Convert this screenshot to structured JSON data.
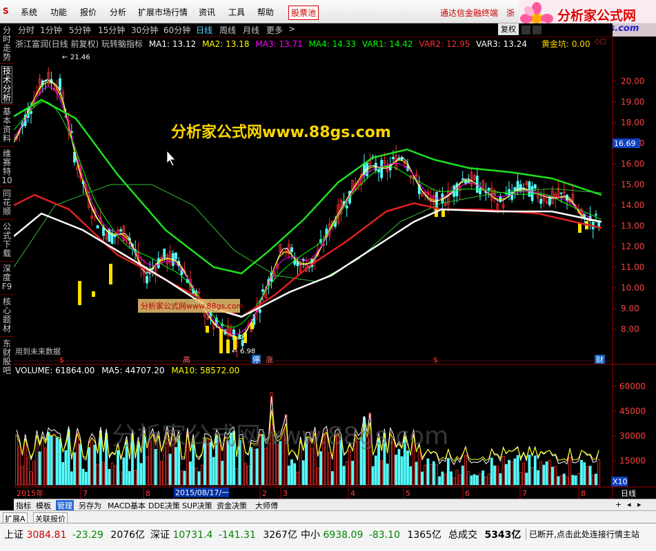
{
  "menu": {
    "items": [
      "系统",
      "功能",
      "报价",
      "分析",
      "扩展市场行情",
      "资讯",
      "工具",
      "帮助"
    ],
    "stocks_button": "股票池",
    "promo1": "通达信金融终端",
    "promo2": "浙"
  },
  "logo": {
    "name": "分析家公式网",
    "url": "www.88gs.com"
  },
  "periods": [
    "分时",
    "1分钟",
    "5分钟",
    "15分钟",
    "30分钟",
    "60分钟",
    "日线",
    "周线",
    "月线",
    "更多"
  ],
  "active_period": "日线",
  "fuquan": "复权",
  "left_tabs": [
    "分时走势",
    "技术分析",
    "基本资料",
    "维赛特10",
    "同花顺",
    "公式下载",
    "深度F9",
    "核心题材",
    "东财股吧"
  ],
  "main_legend": {
    "title": "浙江富润(日线 前复权) 玩转脑指标",
    "items": [
      {
        "label": "MA1: 13.12",
        "color": "#ffffff"
      },
      {
        "label": "MA2: 13.18",
        "color": "#ffff00"
      },
      {
        "label": "MA3: 13.71",
        "color": "#ff00ff"
      },
      {
        "label": "MA4: 14.33",
        "color": "#00ff00"
      },
      {
        "label": "VAR1: 14.42",
        "color": "#00ff00"
      },
      {
        "label": "VAR2: 12.95",
        "color": "#ff3030"
      },
      {
        "label": "VAR3: 13.24",
        "color": "#ffffff"
      }
    ],
    "right": "黄金坑: 0.00"
  },
  "price_axis": {
    "labels": [
      "20.00",
      "19.00",
      "18.00",
      "17.00",
      "16.00",
      "15.00",
      "14.00",
      "13.00",
      "12.00",
      "11.00",
      "10.00",
      "9.00",
      "8.00"
    ],
    "current": "16.69"
  },
  "annotations": {
    "high": "21.46",
    "low": "6.98",
    "watermark": "分析家公式网www.88gs.com",
    "box": "分析家公式网www.88gs.com",
    "future": "用到未来数据",
    "gao": "高",
    "ting": "停",
    "zhang": "涨",
    "cai": "财"
  },
  "volume_legend": [
    {
      "label": "VOLUME: 61864.00",
      "color": "#ffffff"
    },
    {
      "label": "MA5: 44707.20",
      "color": "#ffffff"
    },
    {
      "label": "MA10: 58572.00",
      "color": "#ffff00"
    }
  ],
  "volume_axis": [
    "60000",
    "45000",
    "30000",
    "15000"
  ],
  "volume_watermark": "分析家公式网www.88gs.com",
  "x10": "X10",
  "date_axis": {
    "year": "2015年",
    "ticks": [
      "7",
      "8",
      "2",
      "3",
      "4",
      "5",
      "6",
      "7",
      "8"
    ],
    "cursor": "2015/08/17/一",
    "right": "日线"
  },
  "bottom_tabs": [
    "指标",
    "模板",
    "管理",
    "另存为",
    "MACD基本",
    "DDE决策",
    "SUP决策",
    "资金决策",
    "大师傅"
  ],
  "active_bottom": "管理",
  "ext_tabs": [
    "扩展A",
    "关联报价"
  ],
  "status": [
    {
      "name": "上证",
      "price": "3084.81",
      "chg": "-23.29",
      "amt": "2076亿"
    },
    {
      "name": "深证",
      "price": "10731.4",
      "chg": "-141.31",
      "amt": "3267亿"
    },
    {
      "name": "中小",
      "price": "6938.09",
      "chg": "-83.10",
      "amt": "1365亿"
    }
  ],
  "total": {
    "label": "总成交",
    "value": "5343亿"
  },
  "message": "已断开,点击此处连接行情主站"
}
